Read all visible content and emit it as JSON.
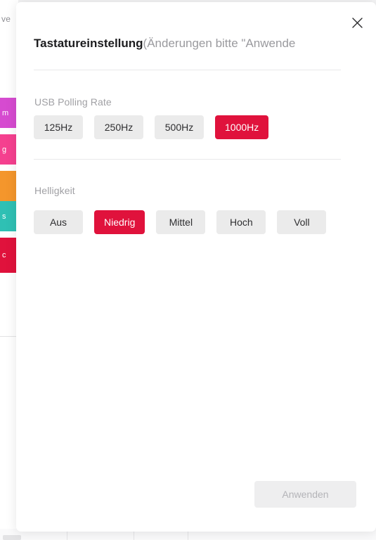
{
  "background": {
    "left_text_fragment": "ve",
    "color_items": [
      {
        "label": "m",
        "color": "#d64bd0"
      },
      {
        "label": "g",
        "color": "#f5408f"
      },
      {
        "label": "",
        "color": "#f4962c"
      },
      {
        "label": "s",
        "color": "#2fc0b4"
      },
      {
        "label": "c",
        "color": "#e0123c"
      }
    ]
  },
  "modal": {
    "close_icon": "close-icon",
    "title_main": "Tastatureinstellung",
    "title_note": "(Änderungen bitte \"Anwende",
    "sections": [
      {
        "label": "USB Polling Rate",
        "options": [
          {
            "label": "125Hz",
            "selected": false
          },
          {
            "label": "250Hz",
            "selected": false
          },
          {
            "label": "500Hz",
            "selected": false
          },
          {
            "label": "1000Hz",
            "selected": true
          }
        ]
      },
      {
        "label": "Helligkeit",
        "options": [
          {
            "label": "Aus",
            "selected": false
          },
          {
            "label": "Niedrig",
            "selected": true
          },
          {
            "label": "Mittel",
            "selected": false
          },
          {
            "label": "Hoch",
            "selected": false
          },
          {
            "label": "Voll",
            "selected": false
          }
        ]
      }
    ],
    "apply_button": {
      "label": "Anwenden",
      "disabled": true
    }
  },
  "colors": {
    "accent_selected": "#e0123c",
    "option_unselected_bg": "#ebebeb",
    "modal_bg": "#ffffff",
    "page_bg": "#f1f1f2",
    "divider": "#e8e8ea",
    "label_gray": "#a0a0a4",
    "disabled_text": "#b4b4b8"
  }
}
